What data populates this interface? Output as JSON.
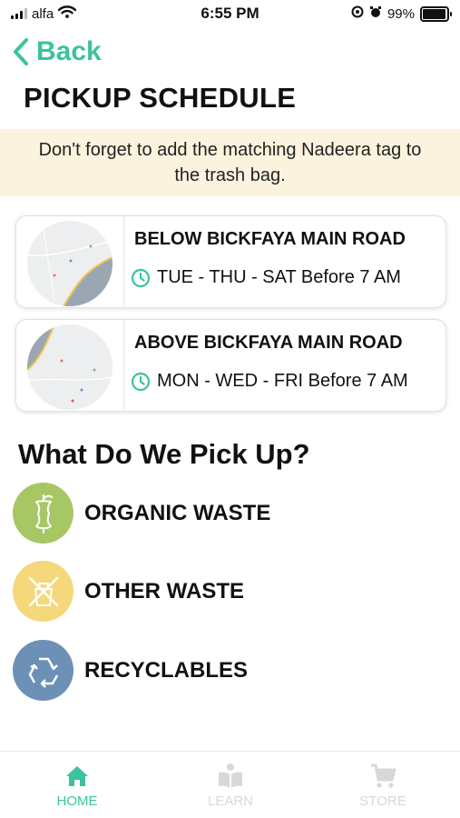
{
  "status_bar": {
    "carrier": "alfa",
    "time": "6:55 PM",
    "battery": "99%"
  },
  "nav": {
    "back_label": "Back"
  },
  "page_title": "PICKUP SCHEDULE",
  "banner_text": "Don't forget to add the matching Nadeera tag to the trash bag.",
  "schedules": [
    {
      "road": "BELOW BICKFAYA MAIN ROAD",
      "when": "TUE - THU - SAT Before 7 AM"
    },
    {
      "road": "ABOVE BICKFAYA MAIN ROAD",
      "when": "MON - WED - FRI Before 7 AM"
    }
  ],
  "pickup_section": {
    "title": "What Do We Pick Up?",
    "items": [
      {
        "label": "ORGANIC WASTE",
        "color": "#a6c763",
        "icon": "apple-core-icon"
      },
      {
        "label": "OTHER WASTE",
        "color": "#f5d77c",
        "icon": "crossed-out-waste-icon"
      },
      {
        "label": "RECYCLABLES",
        "color": "#6d90b7",
        "icon": "recycle-icon"
      }
    ]
  },
  "tabbar": {
    "tabs": [
      {
        "label": "HOME",
        "icon": "home-icon",
        "active": true
      },
      {
        "label": "LEARN",
        "icon": "learn-icon",
        "active": false
      },
      {
        "label": "STORE",
        "icon": "cart-icon",
        "active": false
      }
    ]
  },
  "colors": {
    "accent": "#3bc39d",
    "banner_bg": "#fbf3de",
    "inactive_tab": "#d8d8d8"
  }
}
